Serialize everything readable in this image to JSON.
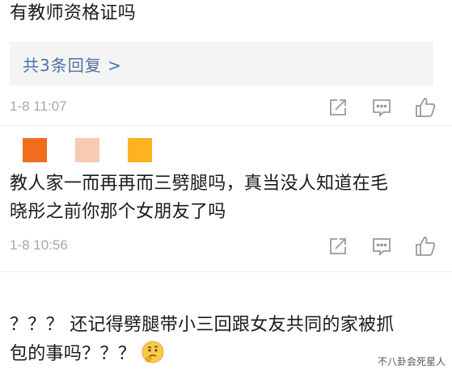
{
  "comments": [
    {
      "text": "有教师资格证吗",
      "replies_label": "共3条回复 >",
      "timestamp": "1-8 11:07"
    },
    {
      "swatch_colors": [
        "#f26c1e",
        "#f7cbb1",
        "#fcb31f"
      ],
      "text_line1": "教人家一而再再而三劈腿吗，真当没人知道在毛",
      "text_line2": "晓彤之前你那个女朋友了吗",
      "timestamp": "1-8 10:56"
    },
    {
      "text_line1": "？？？ 还记得劈腿带小三回跟女友共同的家被抓",
      "text_line2": "包的事吗？？？",
      "emoji": "thinking-face-icon"
    }
  ],
  "watermark": "不八卦会死星人",
  "colors": {
    "link": "#4c73a6",
    "meta": "#a8a8a8",
    "icon_stroke": "#9a9a9a"
  }
}
